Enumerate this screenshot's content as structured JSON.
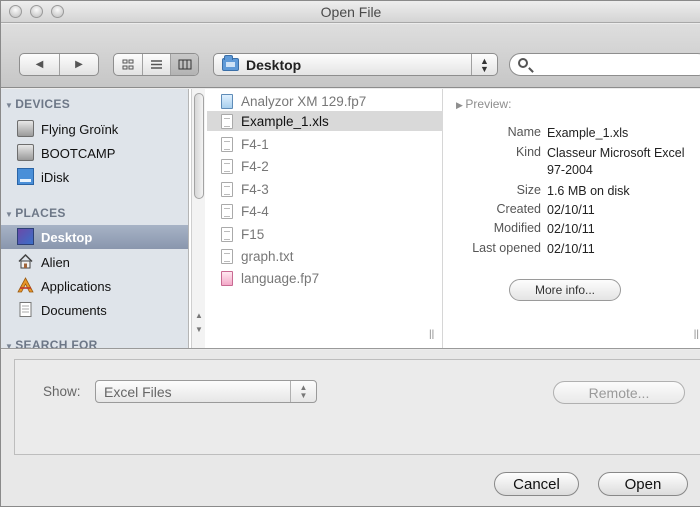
{
  "window": {
    "title": "Open File"
  },
  "toolbar": {
    "back_icon": "◀",
    "forward_icon": "▶",
    "view_icons": [
      "icon-view-icon",
      "list-view-icon",
      "column-view-icon"
    ],
    "location": "Desktop",
    "search_placeholder": "",
    "search_value": ""
  },
  "sidebar": {
    "devices_header": "DEVICES",
    "devices": [
      {
        "label": "Flying Groïnk",
        "icon": "hard-drive-icon"
      },
      {
        "label": "BOOTCAMP",
        "icon": "hard-drive-icon"
      },
      {
        "label": "iDisk",
        "icon": "idisk-icon"
      }
    ],
    "places_header": "PLACES",
    "places": [
      {
        "label": "Desktop",
        "icon": "desktop-icon",
        "selected": true
      },
      {
        "label": "Alien",
        "icon": "home-icon"
      },
      {
        "label": "Applications",
        "icon": "applications-icon"
      },
      {
        "label": "Documents",
        "icon": "documents-icon"
      }
    ],
    "search_header": "SEARCH FOR"
  },
  "files": [
    {
      "name": "Analyzor XM 129.fp7",
      "icon": "filemaker-icon"
    },
    {
      "name": "Example_1.xls",
      "icon": "document-icon",
      "selected": true
    },
    {
      "name": "F4-1",
      "icon": "document-icon"
    },
    {
      "name": "F4-2",
      "icon": "document-icon"
    },
    {
      "name": "F4-3",
      "icon": "document-icon"
    },
    {
      "name": "F4-4",
      "icon": "document-icon"
    },
    {
      "name": "F15",
      "icon": "document-icon"
    },
    {
      "name": "graph.txt",
      "icon": "text-file-icon"
    },
    {
      "name": "language.fp7",
      "icon": "filemaker-icon"
    }
  ],
  "preview": {
    "header": "Preview:",
    "name_key": "Name",
    "name": "Example_1.xls",
    "kind_key": "Kind",
    "kind": "Classeur Microsoft Excel 97-2004",
    "size_key": "Size",
    "size": "1.6 MB on disk",
    "created_key": "Created",
    "created": "02/10/11",
    "modified_key": "Modified",
    "modified": "02/10/11",
    "opened_key": "Last opened",
    "opened": "02/10/11",
    "more_info": "More info..."
  },
  "bottom": {
    "show_label": "Show:",
    "show_value": "Excel Files",
    "remote": "Remote...",
    "cancel": "Cancel",
    "open": "Open"
  }
}
